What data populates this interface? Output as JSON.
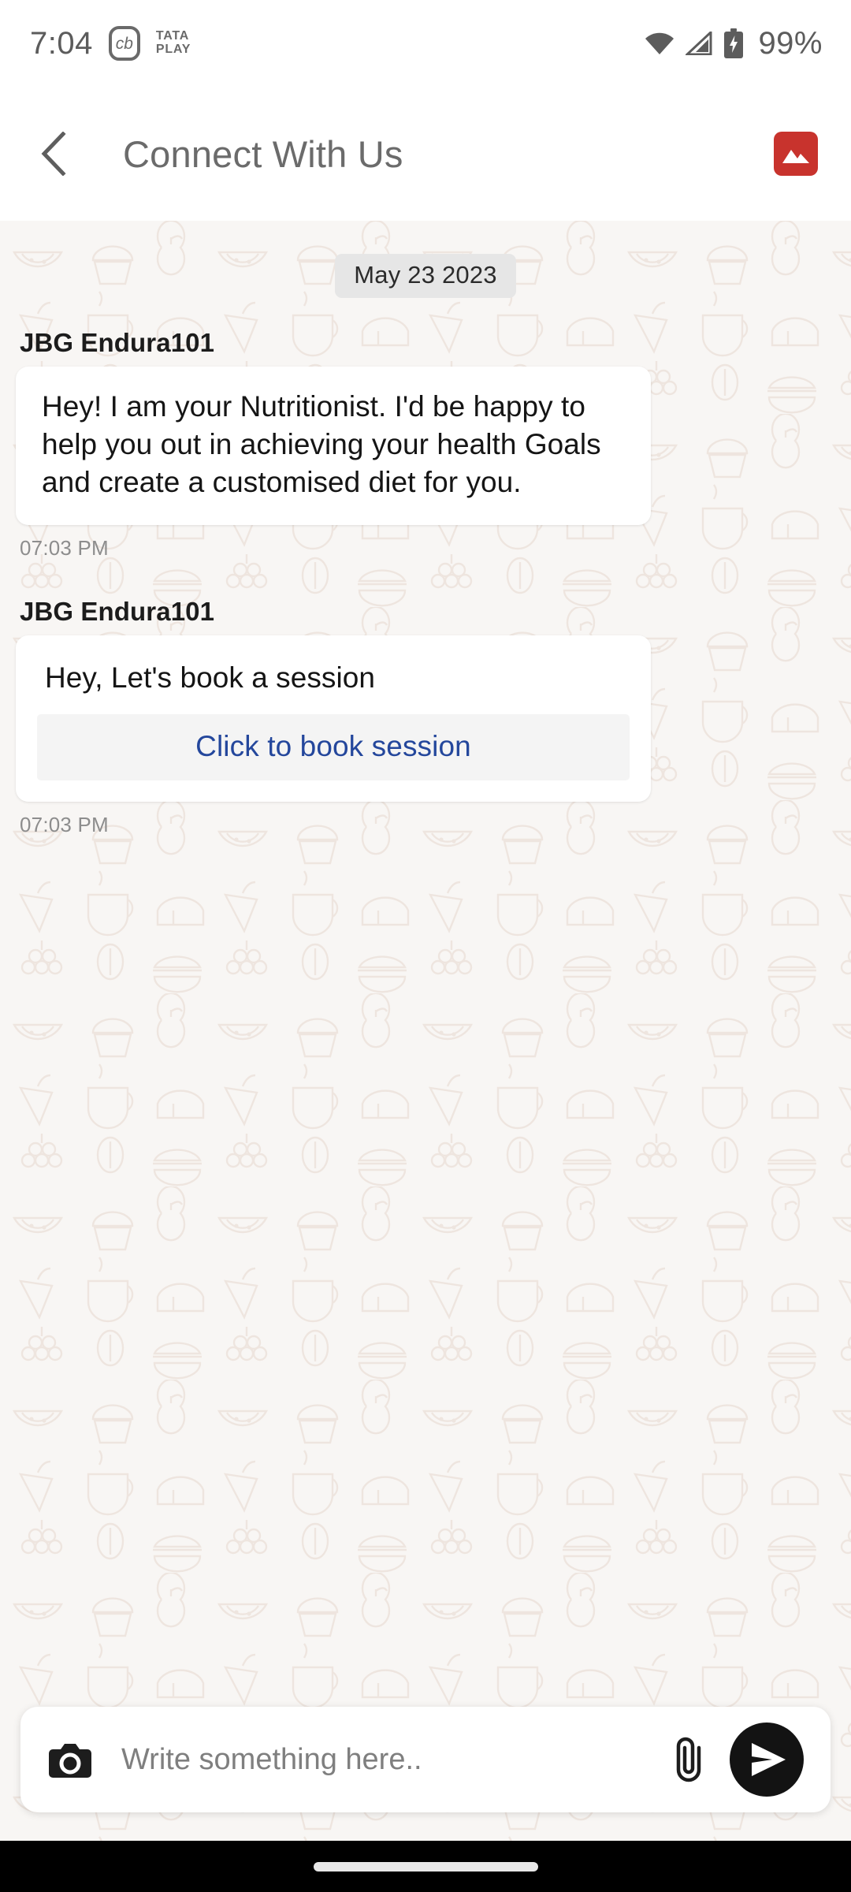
{
  "status_bar": {
    "clock": "7:04",
    "carrier_badge": "cb",
    "carrier_line1": "TATA",
    "carrier_line2": "PLAY",
    "wifi_icon": "wifi-icon",
    "signal_icon": "cellular-signal-icon",
    "battery_icon": "battery-charging-icon",
    "battery_percent": "99%"
  },
  "app_bar": {
    "back_icon": "chevron-left-icon",
    "title": "Connect With Us",
    "brand_icon": "image-placeholder-icon",
    "brand_color": "#c8332d"
  },
  "chat": {
    "date_separator": "May 23 2023",
    "messages": [
      {
        "sender": "JBG  Endura101",
        "text": "Hey! I am your Nutritionist. I'd be happy to help you out in achieving your health Goals and create a customised diet for you.",
        "time": "07:03 PM"
      },
      {
        "sender": "JBG  Endura101",
        "text": "Hey, Let's book a session",
        "action_label": "Click to book session",
        "action_color": "#24479c",
        "time": "07:03 PM"
      }
    ]
  },
  "composer": {
    "camera_icon": "camera-icon",
    "input_value": "",
    "input_placeholder": "Write something here..",
    "attach_icon": "paperclip-icon",
    "send_icon": "send-paper-plane-icon"
  },
  "nav_bar": {
    "gesture_pill": "home-gesture-pill"
  }
}
